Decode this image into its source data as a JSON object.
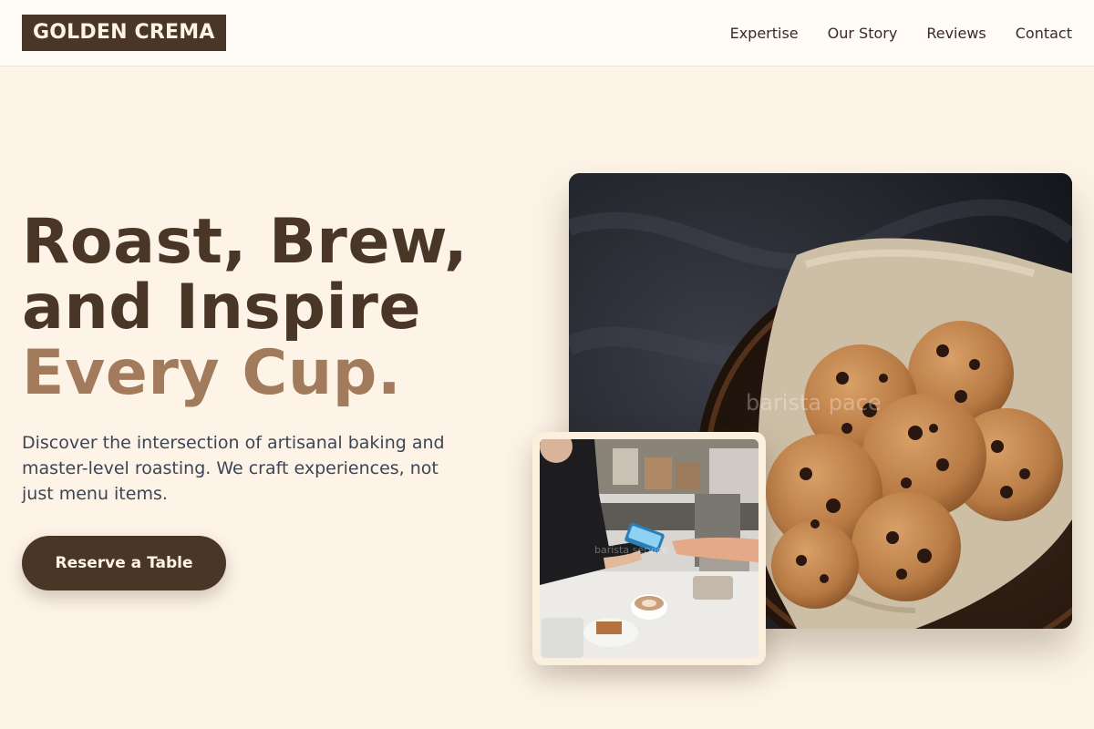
{
  "header": {
    "logo": "GOLDEN CREMA",
    "nav": [
      "Expertise",
      "Our Story",
      "Reviews",
      "Contact"
    ]
  },
  "hero": {
    "headline_line1": "Roast, Brew,",
    "headline_line2": "and Inspire",
    "headline_accent": "Every Cup.",
    "subtext": "Discover the intersection of artisanal baking and master-level roasting. We craft experiences, not just menu items.",
    "cta_label": "Reserve a Table"
  },
  "images": {
    "main_watermark": "barista pace",
    "inset_watermark": "barista service"
  },
  "colors": {
    "brand": "#4a3627",
    "accent": "#a27b5c",
    "background": "#fdf4e7",
    "header_bg": "#fffcf7"
  }
}
